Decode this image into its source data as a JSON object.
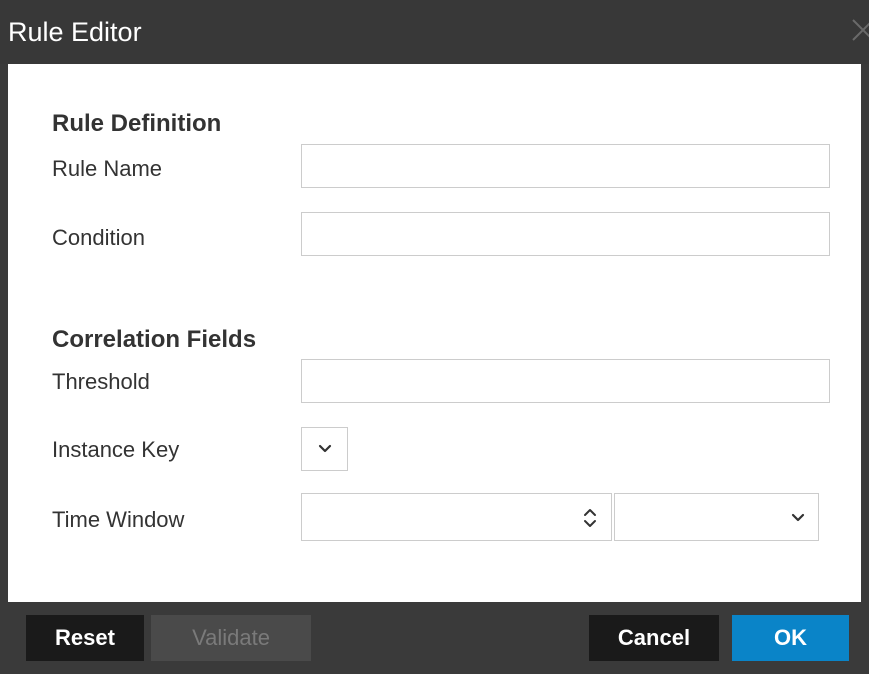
{
  "window": {
    "title": "Rule Editor"
  },
  "rule_definition": {
    "heading": "Rule Definition",
    "rule_name_label": "Rule Name",
    "rule_name_value": "",
    "condition_label": "Condition",
    "condition_value": ""
  },
  "correlation_fields": {
    "heading": "Correlation Fields",
    "threshold_label": "Threshold",
    "threshold_value": "",
    "instance_key_label": "Instance Key",
    "instance_key_value": "",
    "time_window_label": "Time Window",
    "time_window_value": "",
    "time_window_unit": ""
  },
  "footer": {
    "reset_label": "Reset",
    "validate_label": "Validate",
    "cancel_label": "Cancel",
    "ok_label": "OK"
  },
  "colors": {
    "titlebar": "#383838",
    "footer": "#3a3a3a",
    "primary_button": "#0a84c8",
    "dark_button": "#1a1a1a",
    "disabled_button": "#4a4a4a"
  },
  "icons": {
    "close": "close-icon",
    "dropdown": "chevron-down-icon",
    "spinner": "up-down-chevron-icon"
  }
}
